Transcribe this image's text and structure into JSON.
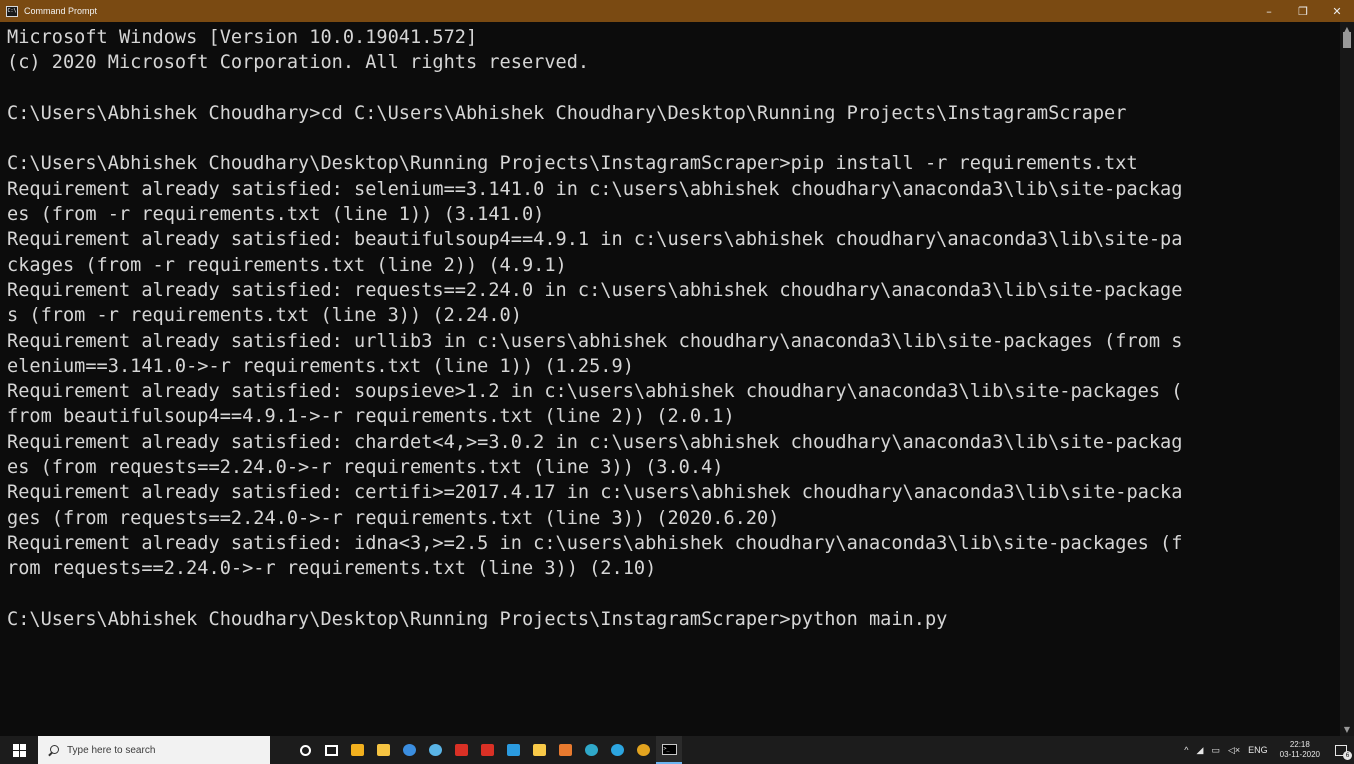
{
  "window": {
    "title": "Command Prompt",
    "minimize_glyph": "–",
    "maximize_glyph": "❐",
    "close_glyph": "✕"
  },
  "console": {
    "lines": [
      "Microsoft Windows [Version 10.0.19041.572]",
      "(c) 2020 Microsoft Corporation. All rights reserved.",
      "",
      "C:\\Users\\Abhishek Choudhary>cd C:\\Users\\Abhishek Choudhary\\Desktop\\Running Projects\\InstagramScraper",
      "",
      "C:\\Users\\Abhishek Choudhary\\Desktop\\Running Projects\\InstagramScraper>pip install -r requirements.txt",
      "Requirement already satisfied: selenium==3.141.0 in c:\\users\\abhishek choudhary\\anaconda3\\lib\\site-packag",
      "es (from -r requirements.txt (line 1)) (3.141.0)",
      "Requirement already satisfied: beautifulsoup4==4.9.1 in c:\\users\\abhishek choudhary\\anaconda3\\lib\\site-pa",
      "ckages (from -r requirements.txt (line 2)) (4.9.1)",
      "Requirement already satisfied: requests==2.24.0 in c:\\users\\abhishek choudhary\\anaconda3\\lib\\site-package",
      "s (from -r requirements.txt (line 3)) (2.24.0)",
      "Requirement already satisfied: urllib3 in c:\\users\\abhishek choudhary\\anaconda3\\lib\\site-packages (from s",
      "elenium==3.141.0->-r requirements.txt (line 1)) (1.25.9)",
      "Requirement already satisfied: soupsieve>1.2 in c:\\users\\abhishek choudhary\\anaconda3\\lib\\site-packages (",
      "from beautifulsoup4==4.9.1->-r requirements.txt (line 2)) (2.0.1)",
      "Requirement already satisfied: chardet<4,>=3.0.2 in c:\\users\\abhishek choudhary\\anaconda3\\lib\\site-packag",
      "es (from requests==2.24.0->-r requirements.txt (line 3)) (3.0.4)",
      "Requirement already satisfied: certifi>=2017.4.17 in c:\\users\\abhishek choudhary\\anaconda3\\lib\\site-packa",
      "ges (from requests==2.24.0->-r requirements.txt (line 3)) (2020.6.20)",
      "Requirement already satisfied: idna<3,>=2.5 in c:\\users\\abhishek choudhary\\anaconda3\\lib\\site-packages (f",
      "rom requests==2.24.0->-r requirements.txt (line 3)) (2.10)",
      "",
      "C:\\Users\\Abhishek Choudhary\\Desktop\\Running Projects\\InstagramScraper>python main.py"
    ]
  },
  "taskbar": {
    "search_placeholder": "Type here to search",
    "apps": [
      {
        "name": "cortana-icon",
        "kind": "cortana"
      },
      {
        "name": "task-view-icon",
        "kind": "taskview"
      },
      {
        "name": "store-icon",
        "color": "#f2b01e"
      },
      {
        "name": "file-explorer-icon",
        "color": "#f5c342"
      },
      {
        "name": "onedrive-icon",
        "color": "#3b8ee0"
      },
      {
        "name": "ubuntu-icon",
        "color": "#5ab4e6"
      },
      {
        "name": "gmail-icon",
        "color": "#d93025"
      },
      {
        "name": "gmail-icon",
        "color": "#d93025"
      },
      {
        "name": "photos-icon",
        "color": "#2b9be0"
      },
      {
        "name": "sticky-notes-icon",
        "color": "#f7c948"
      },
      {
        "name": "powerpoint-icon",
        "color": "#e87a2f"
      },
      {
        "name": "edge-icon",
        "color": "#2fa8c9"
      },
      {
        "name": "telegram-icon",
        "color": "#2ca5e0"
      },
      {
        "name": "chrome-icon",
        "color": "#e2a31f"
      },
      {
        "name": "command-prompt-icon",
        "kind": "terminal"
      }
    ]
  },
  "tray": {
    "chevron": "^",
    "language": "ENG",
    "time": "22:18",
    "date": "03-11-2020",
    "notification_count": "6"
  }
}
